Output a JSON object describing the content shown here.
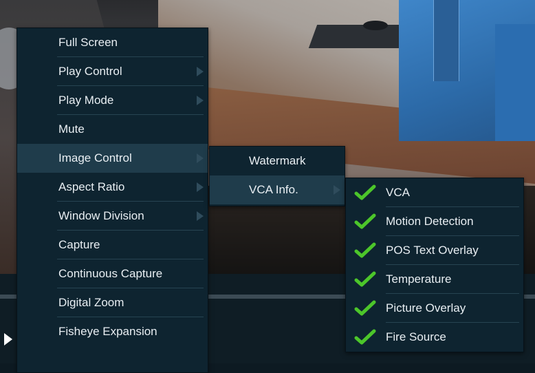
{
  "main_menu": {
    "items": [
      {
        "label": "Full Screen",
        "has_submenu": false,
        "highlighted": false
      },
      {
        "label": "Play Control",
        "has_submenu": true,
        "highlighted": false
      },
      {
        "label": "Play Mode",
        "has_submenu": true,
        "highlighted": false
      },
      {
        "label": "Mute",
        "has_submenu": false,
        "highlighted": false
      },
      {
        "label": "Image Control",
        "has_submenu": true,
        "highlighted": true
      },
      {
        "label": "Aspect Ratio",
        "has_submenu": true,
        "highlighted": false
      },
      {
        "label": "Window Division",
        "has_submenu": true,
        "highlighted": false
      },
      {
        "label": "Capture",
        "has_submenu": false,
        "highlighted": false
      },
      {
        "label": "Continuous Capture",
        "has_submenu": false,
        "highlighted": false
      },
      {
        "label": "Digital Zoom",
        "has_submenu": false,
        "highlighted": false
      },
      {
        "label": "Fisheye Expansion",
        "has_submenu": false,
        "highlighted": false
      }
    ]
  },
  "image_control_menu": {
    "items": [
      {
        "label": "Watermark",
        "has_submenu": false,
        "highlighted": false
      },
      {
        "label": "VCA Info.",
        "has_submenu": true,
        "highlighted": true
      }
    ]
  },
  "vca_info_menu": {
    "items": [
      {
        "label": "VCA",
        "checked": true
      },
      {
        "label": "Motion Detection",
        "checked": true
      },
      {
        "label": "POS Text Overlay",
        "checked": true
      },
      {
        "label": "Temperature",
        "checked": true
      },
      {
        "label": "Picture Overlay",
        "checked": true
      },
      {
        "label": "Fire Source",
        "checked": true
      }
    ]
  },
  "colors": {
    "menu_bg": "#0e2430",
    "highlight_bg": "#1f3c4b",
    "text": "#e8eef2",
    "check_green": "#4cc62a"
  },
  "icons": {
    "check": "checkmark-icon",
    "submenu_arrow": "chevron-right-icon",
    "play": "play-icon"
  }
}
